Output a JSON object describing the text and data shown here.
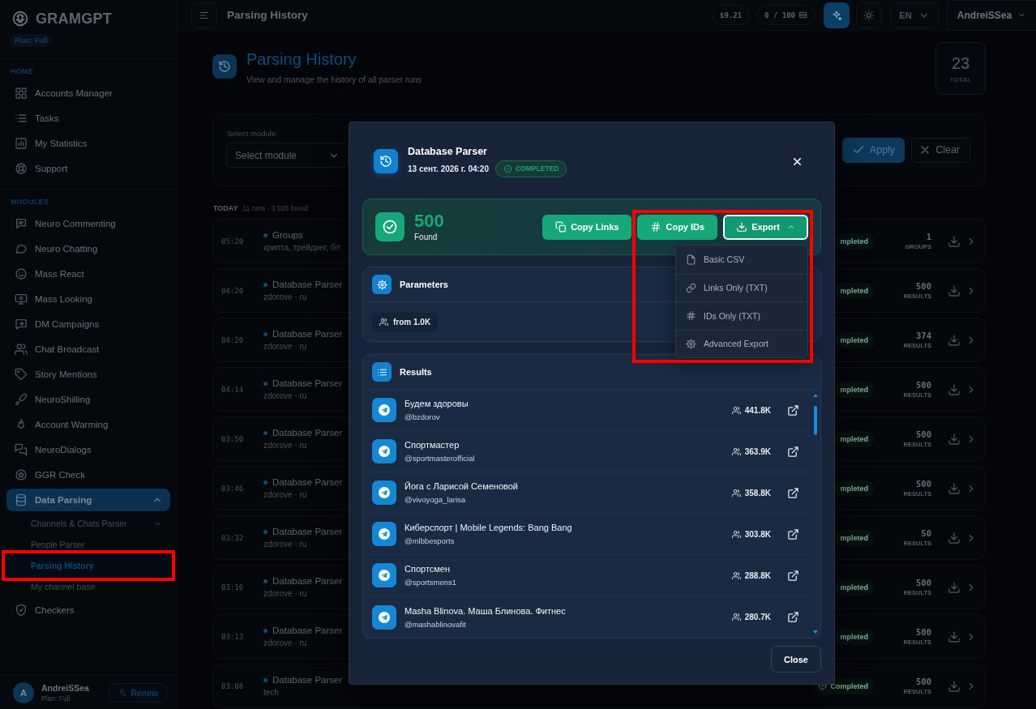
{
  "sidebar": {
    "brand": "GRAMGPT",
    "plan_badge": "Plan: Full",
    "sections": [
      {
        "title": "HOME",
        "items": [
          {
            "label": "Accounts Manager",
            "selected": false
          },
          {
            "label": "Tasks",
            "selected": false
          },
          {
            "label": "My Statistics",
            "selected": false
          },
          {
            "label": "Support",
            "selected": false
          }
        ]
      },
      {
        "title": "MODULES",
        "items": [
          {
            "label": "Neuro Commenting",
            "selected": false
          },
          {
            "label": "Neuro Chatting",
            "selected": false
          },
          {
            "label": "Mass React",
            "selected": false
          },
          {
            "label": "Mass Looking",
            "selected": false
          },
          {
            "label": "DM Campaigns",
            "selected": false
          },
          {
            "label": "Chat Broadcast",
            "selected": false
          },
          {
            "label": "Story Mentions",
            "selected": false
          },
          {
            "label": "NeuroShilling",
            "selected": false
          },
          {
            "label": "Account Warming",
            "selected": false
          },
          {
            "label": "NeuroDialogs",
            "selected": false
          },
          {
            "label": "GGR Check",
            "selected": false
          },
          {
            "label": "Data Parsing",
            "selected": true,
            "expanded": true,
            "children": [
              {
                "label": "Channels & Chats Parser",
                "selected": false,
                "highlighted": false,
                "expanded": false
              },
              {
                "label": "People Parser",
                "selected": false,
                "highlighted": false
              },
              {
                "label": "Parsing History",
                "selected": true,
                "highlighted": true
              },
              {
                "label": "My channel base",
                "selected": false,
                "highlighted": false
              }
            ]
          },
          {
            "label": "Checkers",
            "selected": false
          }
        ]
      }
    ],
    "user": {
      "initial": "A",
      "name": "AndreiSSea",
      "plan": "Plan: Full",
      "renew_button": "Renew"
    }
  },
  "header": {
    "page_title": "Parsing History",
    "balance": "$9.21",
    "quota": "0 / 100",
    "language": "EN",
    "user": "AndreiSSea"
  },
  "page": {
    "title": "Parsing History",
    "subtitle": "View and manage the history of all parser runs",
    "total": {
      "value": "23",
      "label": "TOTAL"
    },
    "filter": {
      "label": "Select module",
      "select_value": "Select module",
      "apply_button": "Apply",
      "clear_button": "Clear"
    },
    "history": {
      "day": "TODAY",
      "summary": "11 runs · 3 926 found",
      "runs": [
        {
          "time": "05:20",
          "name": "Groups",
          "detail": "крипта, трейдинг, біт",
          "status": "mpleted",
          "status_icon": false,
          "count": "1",
          "unit": "GROUPS"
        },
        {
          "time": "04:20",
          "name": "Database Parser",
          "detail": "zdorove · ru",
          "status": "mpleted",
          "status_icon": false,
          "count": "500",
          "unit": "RESULTS"
        },
        {
          "time": "04:20",
          "name": "Database Parser",
          "detail": "zdorove · ru",
          "status": "mpleted",
          "status_icon": false,
          "count": "374",
          "unit": "RESULTS"
        },
        {
          "time": "04:14",
          "name": "Database Parser",
          "detail": "zdorove · ru",
          "status": "mpleted",
          "status_icon": false,
          "count": "500",
          "unit": "RESULTS"
        },
        {
          "time": "03:50",
          "name": "Database Parser",
          "detail": "zdorove · ru",
          "status": "mpleted",
          "status_icon": false,
          "count": "500",
          "unit": "RESULTS"
        },
        {
          "time": "03:46",
          "name": "Database Parser",
          "detail": "zdorove · ru",
          "status": "mpleted",
          "status_icon": false,
          "count": "500",
          "unit": "RESULTS"
        },
        {
          "time": "03:32",
          "name": "Database Parser",
          "detail": "zdorove · ru",
          "status": "mpleted",
          "status_icon": false,
          "count": "50",
          "unit": "RESULTS"
        },
        {
          "time": "03:16",
          "name": "Database Parser",
          "detail": "zdorove · ru",
          "status": "mpleted",
          "status_icon": false,
          "count": "500",
          "unit": "RESULTS"
        },
        {
          "time": "03:13",
          "name": "Database Parser",
          "detail": "zdorove · ru",
          "status": "mpleted",
          "status_icon": false,
          "count": "500",
          "unit": "RESULTS"
        },
        {
          "time": "03:08",
          "name": "Database Parser",
          "detail": "tech",
          "status": "Completed",
          "status_icon": true,
          "count": "500",
          "unit": "RESULTS"
        }
      ]
    }
  },
  "modal": {
    "title": "Database Parser",
    "date": "13 сент. 2026 г. 04:20",
    "status": "COMPLETED",
    "summary": {
      "count": "500",
      "label": "Found",
      "buttons": [
        {
          "label": "Copy Links",
          "kind": "copy",
          "highlighted": false,
          "open": false
        },
        {
          "label": "Copy IDs",
          "kind": "hash",
          "highlighted": true,
          "open": false
        },
        {
          "label": "Export",
          "kind": "export",
          "highlighted": true,
          "open": true
        }
      ],
      "export_menu": {
        "highlighted": true,
        "items": [
          {
            "label": "Basic CSV",
            "kind": "file"
          },
          {
            "label": "Links Only (TXT)",
            "kind": "link"
          },
          {
            "label": "IDs Only (TXT)",
            "kind": "hash"
          },
          {
            "label": "Advanced Export",
            "kind": "gear"
          }
        ]
      }
    },
    "parameters": {
      "title": "Parameters",
      "chips": [
        "from 1.0K"
      ]
    },
    "results": {
      "title": "Results",
      "items": [
        {
          "name": "Будем здоровы",
          "handle": "@bzdorov",
          "subscribers": "441.8K"
        },
        {
          "name": "Спортмастер",
          "handle": "@sportmasterofficial",
          "subscribers": "363.9K"
        },
        {
          "name": "Йога с Ларисой Семеновой",
          "handle": "@vivoyoga_larisa",
          "subscribers": "358.8K"
        },
        {
          "name": "Киберспорт | Mobile Legends: Bang Bang",
          "handle": "@mlbbesports",
          "subscribers": "303.8K"
        },
        {
          "name": "Спортсмен",
          "handle": "@sportsmens1",
          "subscribers": "288.8K"
        },
        {
          "name": "Masha Blinova. Маша Блинова. Фитнес",
          "handle": "@mashablinovafit",
          "subscribers": "280.7K"
        }
      ]
    },
    "close_button": "Close"
  }
}
